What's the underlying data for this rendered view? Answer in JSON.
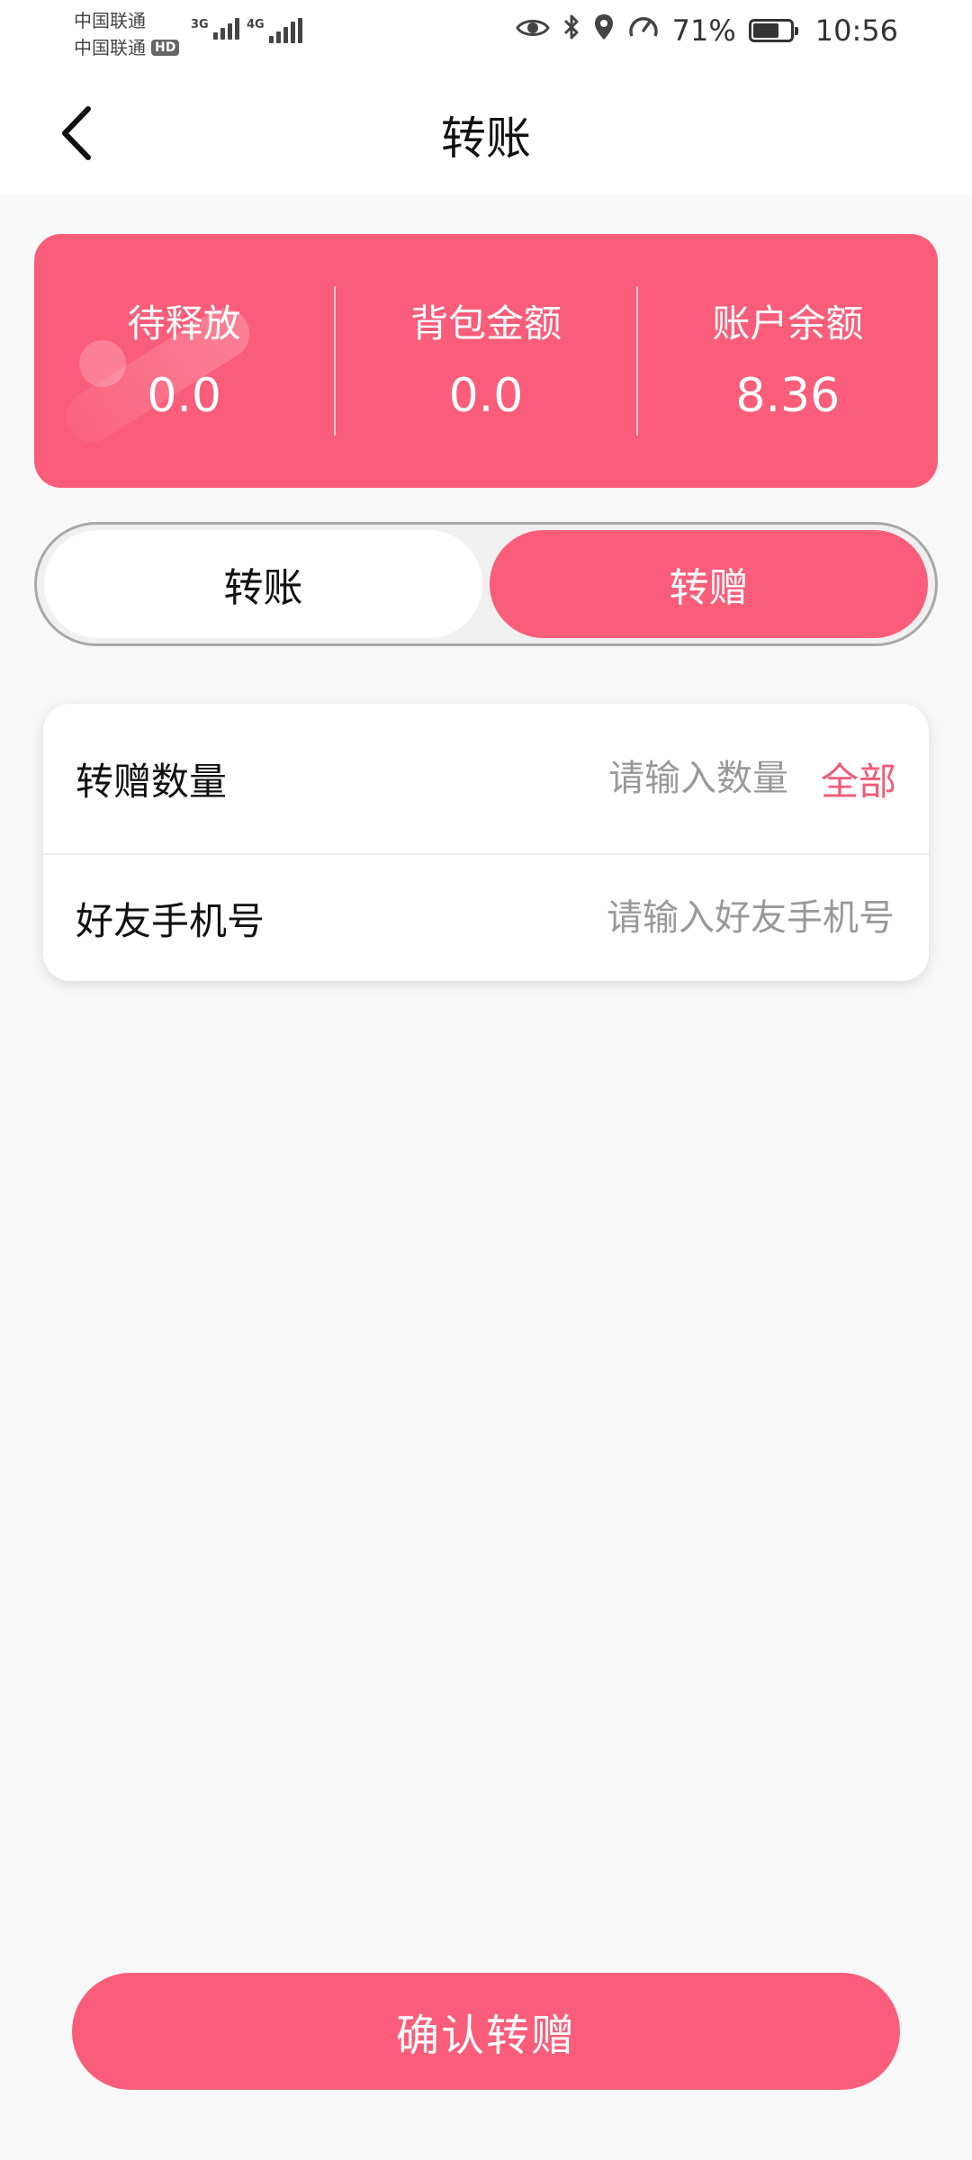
{
  "status_bar": {
    "carrier_1": "中国联通",
    "carrier_2": "中国联通",
    "hd_badge": "HD",
    "net_1": "3G",
    "net_2": "4G",
    "battery_text": "71%",
    "battery_level": 0.71,
    "time": "10:56",
    "icons": [
      "eye-icon",
      "bluetooth-icon",
      "location-icon",
      "speed-icon",
      "battery-icon"
    ]
  },
  "header": {
    "title": "转账",
    "back_icon": "chevron-left-icon"
  },
  "balance_card": {
    "items": [
      {
        "label": "待释放",
        "value": "0.0"
      },
      {
        "label": "背包金额",
        "value": "0.0"
      },
      {
        "label": "账户余额",
        "value": "8.36"
      }
    ],
    "color": "#fa5d79"
  },
  "tabs": {
    "items": [
      {
        "label": "转账",
        "active": false
      },
      {
        "label": "转赠",
        "active": true
      }
    ]
  },
  "form": {
    "amount": {
      "label": "转赠数量",
      "placeholder": "请输入数量",
      "value": "",
      "all_label": "全部"
    },
    "phone": {
      "label": "好友手机号",
      "placeholder": "请输入好友手机号",
      "value": ""
    }
  },
  "confirm_button": {
    "label": "确认转赠"
  },
  "colors": {
    "accent": "#fa5d79",
    "background": "#f8f8f8"
  }
}
